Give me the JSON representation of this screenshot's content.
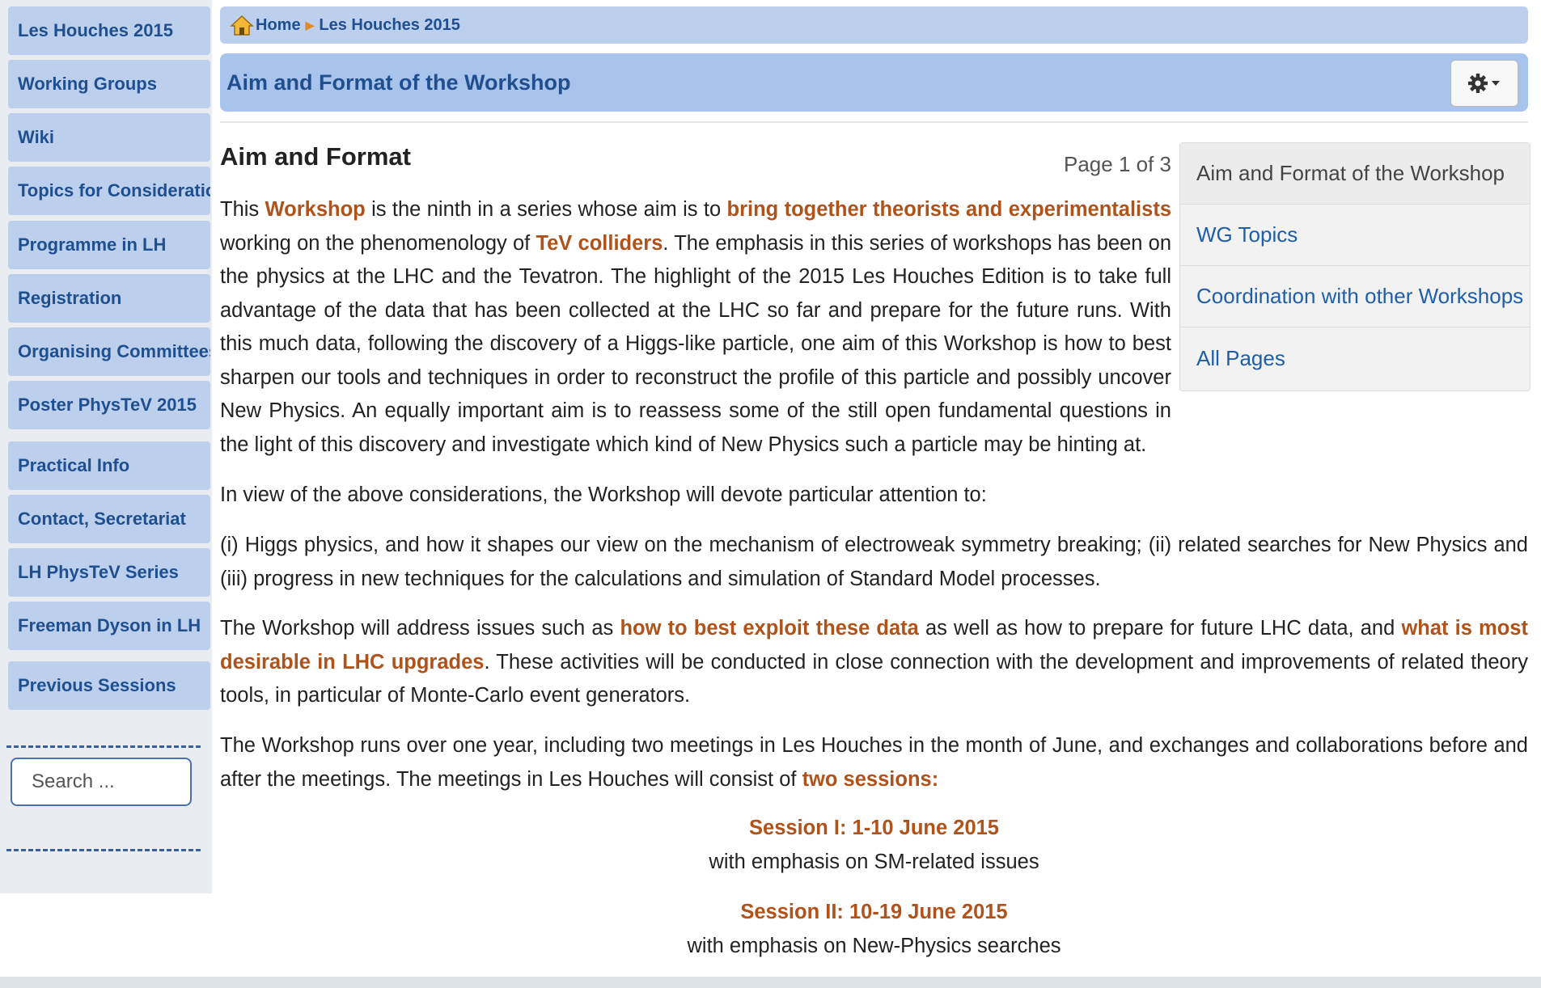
{
  "sidebar": {
    "items": [
      {
        "label": "Les Houches 2015"
      },
      {
        "label": "Working Groups"
      },
      {
        "label": "Wiki"
      },
      {
        "label": "Topics for Consideration"
      },
      {
        "label": "Programme in LH"
      },
      {
        "label": "Registration"
      },
      {
        "label": "Organising Committees"
      },
      {
        "label": "Poster PhysTeV 2015"
      },
      {
        "label": "Practical Info"
      },
      {
        "label": "Contact, Secretariat"
      },
      {
        "label": "LH PhysTeV Series"
      },
      {
        "label": "Freeman Dyson in LH"
      },
      {
        "label": "Previous Sessions"
      }
    ],
    "search_placeholder": "Search ..."
  },
  "breadcrumb": {
    "home": "Home",
    "current": "Les Houches 2015"
  },
  "header": {
    "title": "Aim and Format of the Workshop",
    "gear_icon": "gear-icon"
  },
  "article": {
    "title": "Aim and Format",
    "page_indicator": "Page 1 of 3",
    "p1": {
      "a": "This ",
      "b": "Workshop",
      "c": " is the ninth in a series whose aim is to ",
      "d": "bring together theorists and experimentalists",
      "e": " working on the phenomenology of ",
      "f": "TeV colliders",
      "g": ". The emphasis in this series of workshops has been on the physics at the LHC and the Tevatron. The highlight of the 2015 Les Houches Edition is to take full advantage of the data that has been collected at the LHC so far and prepare for the future runs. With this much data, following the discovery of a Higgs-like particle, one aim of this Workshop is how to best sharpen our tools and techniques in order to reconstruct the profile of this particle and possibly uncover New Physics. An equally important aim is to reassess some of the still open fundamental questions in the light of this discovery and investigate which kind of New Physics such a particle may be hinting at."
    },
    "p2": "In view of the above considerations, the Workshop will devote particular attention to:",
    "p3": "(i) Higgs physics, and how it shapes our view on the mechanism of electroweak symmetry breaking; (ii) related searches for New Physics and (iii) progress in new techniques for the calculations and simulation of Standard Model processes.",
    "p4": {
      "a": "The Workshop will address issues such as ",
      "b": "how to best exploit these data",
      "c": " as well as how to prepare for future LHC data, and ",
      "d": "what is most desirable in LHC upgrades",
      "e": ". These activities will be conducted in close connection with the development and improvements of related theory tools, in particular of Monte-Carlo event generators."
    },
    "p5": {
      "a": "The Workshop runs over one year, including two meetings in Les Houches in the month of June, and exchanges and collaborations before and after the meetings. The meetings in Les Houches will consist of ",
      "b": "two sessions:"
    },
    "session1_title": "Session I: 1-10 June 2015",
    "session1_desc": "with emphasis on SM-related issues",
    "session2_title": "Session II: 10-19 June 2015",
    "session2_desc": "with emphasis on New-Physics searches"
  },
  "toc": {
    "items": [
      {
        "label": "Aim and Format of the Workshop"
      },
      {
        "label": "WG Topics"
      },
      {
        "label": "Coordination with other Workshops"
      },
      {
        "label": "All Pages"
      }
    ]
  },
  "colors": {
    "accent": "#b0531b",
    "sidebar_bg": "#bcd0ee",
    "title_bar": "#a9c4ec",
    "link": "#1f5ea8"
  }
}
